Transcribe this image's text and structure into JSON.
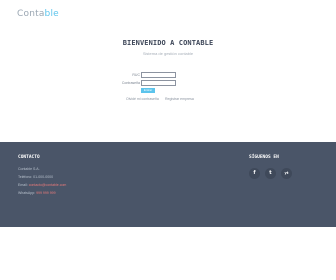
{
  "header": {
    "logo_part1": "Conta",
    "logo_part2": "ble"
  },
  "main": {
    "title": "BIENVENIDO A CONTABLE",
    "subtitle": "Sistema de gestión contable",
    "form": {
      "user_label": "RUC",
      "password_label": "Contraseña",
      "login_label": "Entrar",
      "forgot_link": "Olvidé mi contraseña",
      "register_link": "Registrar empresa"
    }
  },
  "footer": {
    "contact_heading": "CONTACTO",
    "contact_lines": [
      {
        "label": "Contable S.A.",
        "value": ""
      },
      {
        "label": "Teléfono: 01-000-0000",
        "value": ""
      },
      {
        "label": "Email: ",
        "value": "contacto@contable.com"
      },
      {
        "label": "WhatsApp: ",
        "value": "999 999 999"
      }
    ],
    "follow_heading": "SÍGUENOS EN",
    "social": [
      "f",
      "t",
      "yt"
    ]
  },
  "colors": {
    "accent": "#5cc4ec",
    "footer_bg": "#4a5568",
    "title": "#3d4658"
  }
}
